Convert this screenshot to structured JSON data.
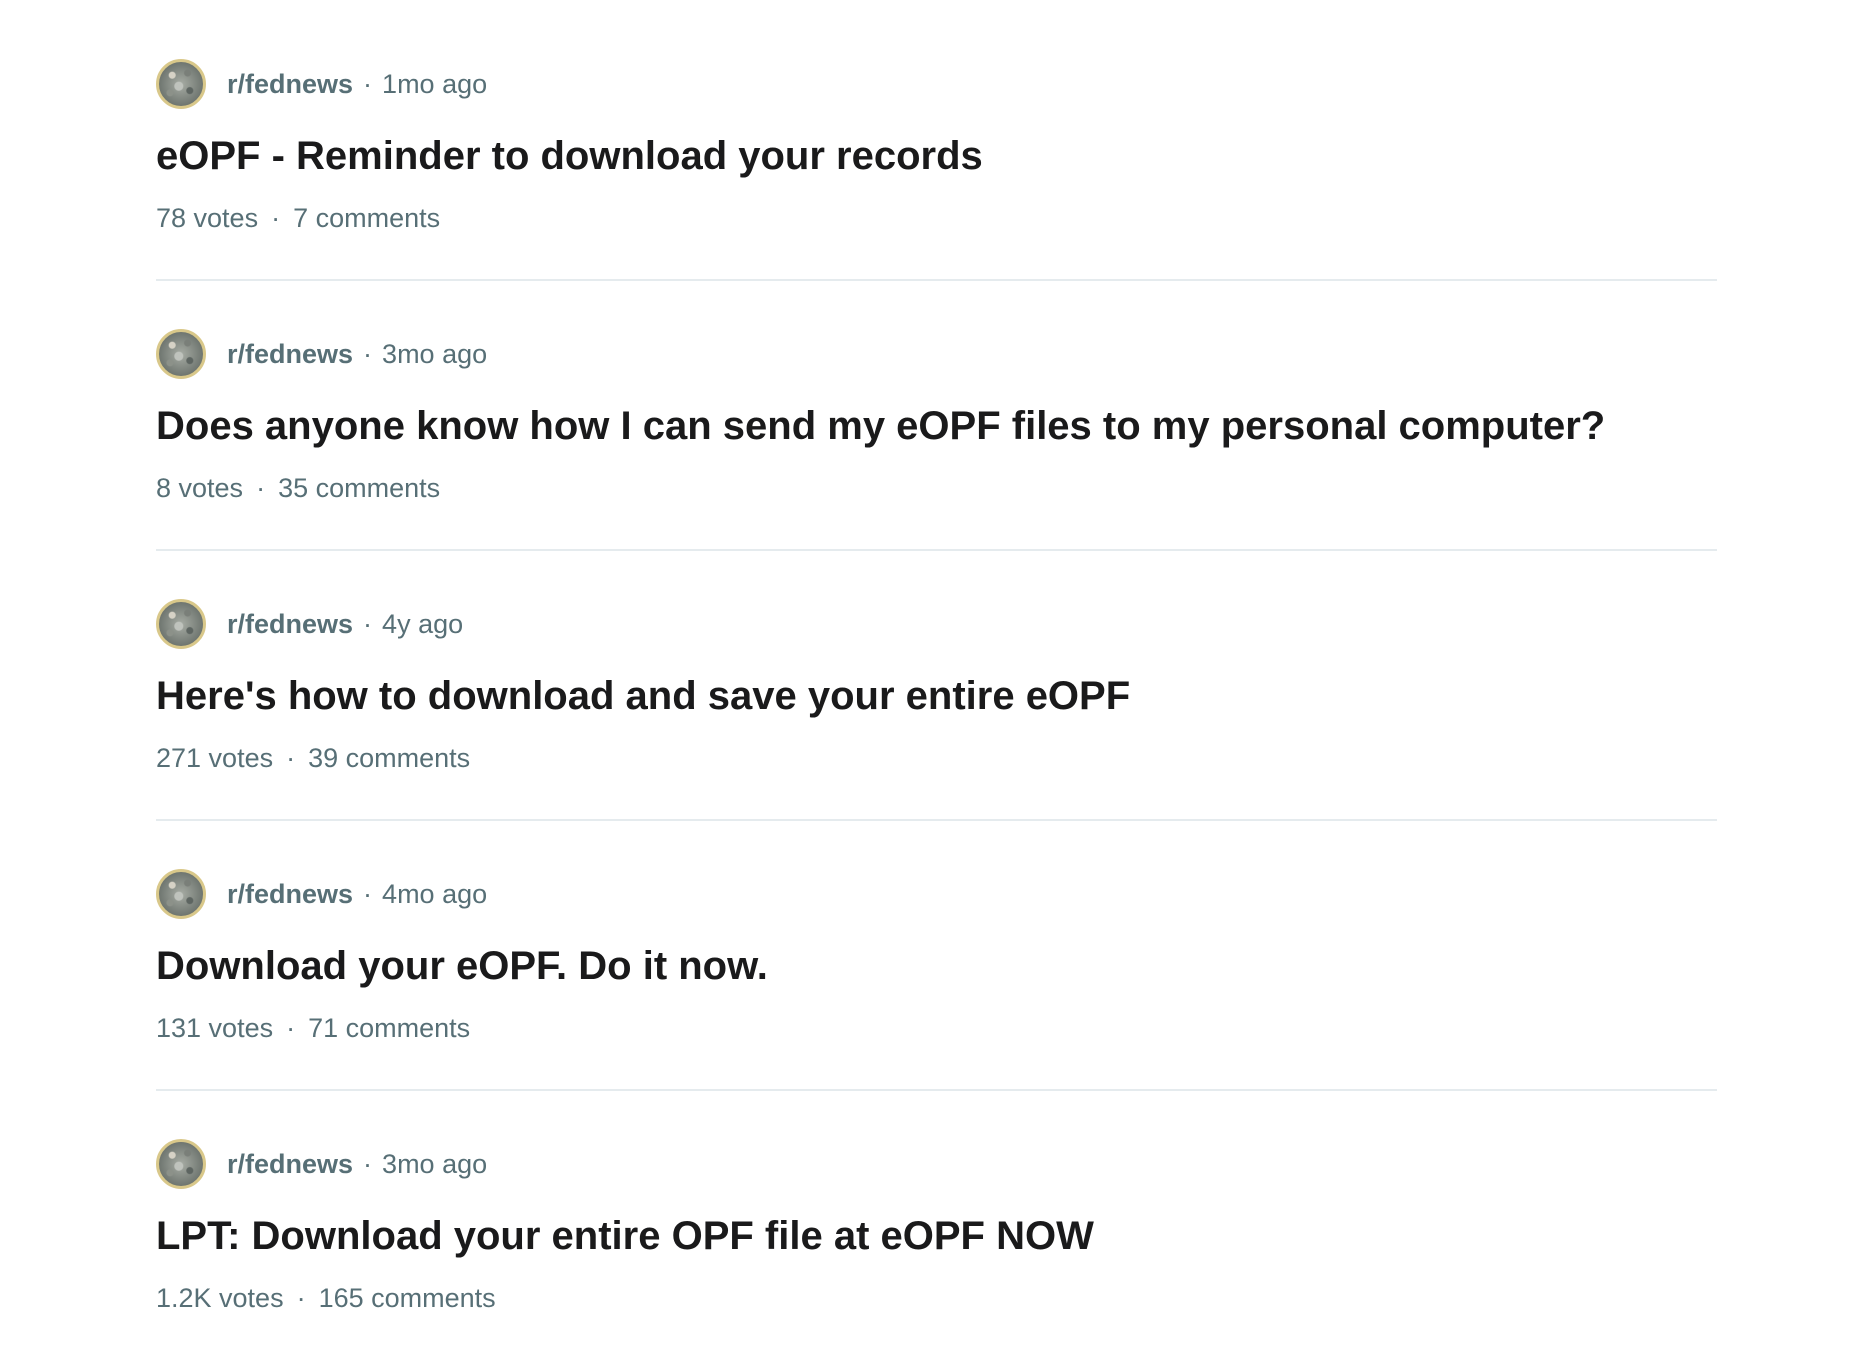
{
  "posts": [
    {
      "subreddit": "r/fednews",
      "separator": "·",
      "time": "1mo ago",
      "title": "eOPF - Reminder to download your records",
      "votes": "78 votes",
      "comments": "7 comments"
    },
    {
      "subreddit": "r/fednews",
      "separator": "·",
      "time": "3mo ago",
      "title": "Does anyone know how I can send my eOPF files to my personal computer?",
      "votes": "8 votes",
      "comments": "35 comments"
    },
    {
      "subreddit": "r/fednews",
      "separator": "·",
      "time": "4y ago",
      "title": "Here's how to download and save your entire eOPF",
      "votes": "271 votes",
      "comments": "39 comments"
    },
    {
      "subreddit": "r/fednews",
      "separator": "·",
      "time": "4mo ago",
      "title": "Download your eOPF. Do it now.",
      "votes": "131 votes",
      "comments": "71 comments"
    },
    {
      "subreddit": "r/fednews",
      "separator": "·",
      "time": "3mo ago",
      "title": "LPT: Download your entire OPF file at eOPF NOW",
      "votes": "1.2K votes",
      "comments": "165 comments"
    }
  ]
}
